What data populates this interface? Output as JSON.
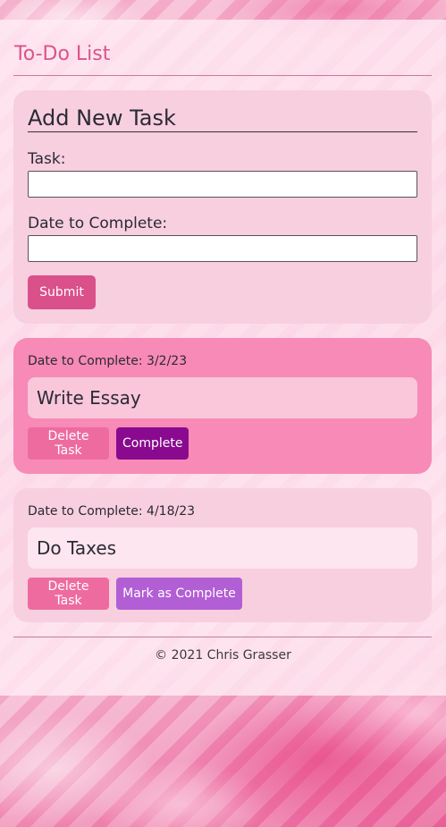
{
  "app": {
    "title": "To-Do List"
  },
  "form": {
    "title": "Add New Task",
    "task_label": "Task:",
    "task_value": "",
    "date_label": "Date to Complete:",
    "date_value": "",
    "submit_label": "Submit"
  },
  "tasks": [
    {
      "date_text": "Date to Complete: 3/2/23",
      "name": "Write Essay",
      "delete_label": "Delete Task",
      "complete_label": "Complete",
      "state": "active"
    },
    {
      "date_text": "Date to Complete: 4/18/23",
      "name": "Do Taxes",
      "delete_label": "Delete Task",
      "complete_label": "Mark as Complete",
      "state": "pending"
    }
  ],
  "footer": {
    "text": "© 2021 Chris Grasser"
  },
  "colors": {
    "accent": "#d9548a",
    "submit": "#da508a",
    "active_card": "#f78ab6",
    "complete_button": "#8a0a8f",
    "mark_complete_button": "#b25ed4",
    "delete_button": "#ee6b9f"
  }
}
